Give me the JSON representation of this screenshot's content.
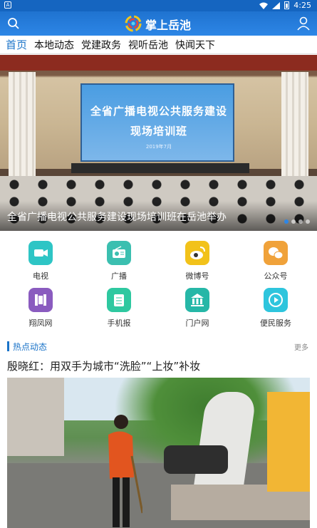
{
  "status_bar": {
    "time": "4:25"
  },
  "header": {
    "title": "掌上岳池"
  },
  "tabs": [
    {
      "label": "首页",
      "active": true
    },
    {
      "label": "本地动态"
    },
    {
      "label": "党建政务"
    },
    {
      "label": "视听岳池"
    },
    {
      "label": "快闻天下"
    }
  ],
  "banner": {
    "screen_line1": "全省广播电视公共服务建设",
    "screen_line2": "现场培训班",
    "screen_line3": "2019年7月",
    "caption": "全省广播电视公共服务建设现场培训班在岳池举办",
    "slide_count": 4,
    "active_slide": 1
  },
  "services": [
    {
      "label": "电视",
      "icon": "video-camera-icon",
      "color": "#2ec5c5"
    },
    {
      "label": "广播",
      "icon": "radio-icon",
      "color": "#3bbfb0"
    },
    {
      "label": "微博号",
      "icon": "weibo-icon",
      "color": "#f2c21a"
    },
    {
      "label": "公众号",
      "icon": "wechat-icon",
      "color": "#f0a23a"
    },
    {
      "label": "翔凤网",
      "icon": "film-icon",
      "color": "#8a5bbf"
    },
    {
      "label": "手机报",
      "icon": "newspaper-icon",
      "color": "#2ec8a0"
    },
    {
      "label": "门户网",
      "icon": "bank-icon",
      "color": "#26b7a7"
    },
    {
      "label": "便民服务",
      "icon": "play-circle-icon",
      "color": "#2ec5dd"
    }
  ],
  "section": {
    "title": "热点动态",
    "more": "更多"
  },
  "headline": "殷晓红：用双手为城市“洗脸”“上妆”补妆",
  "colors": {
    "brand_blue": "#1a73c8",
    "header_blue": "#2d86e6"
  }
}
